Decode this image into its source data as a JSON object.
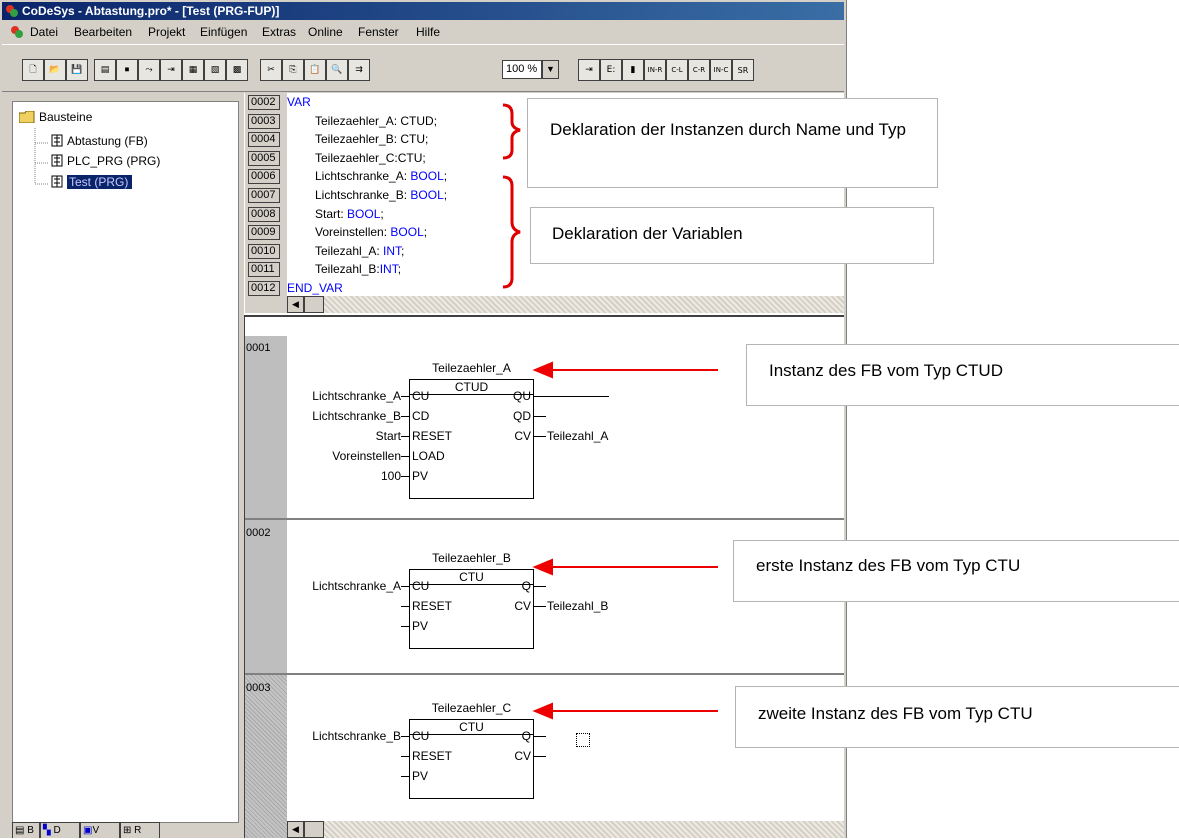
{
  "window": {
    "title": "CoDeSys - Abtastung.pro* - [Test (PRG-FUP)]"
  },
  "menu": [
    "Datei",
    "Bearbeiten",
    "Projekt",
    "Einfügen",
    "Extras",
    "Online",
    "Fenster",
    "Hilfe"
  ],
  "toolbar": {
    "zoom_value": "100 %",
    "fbd_buttons": [
      "⇥",
      "E:",
      "▮",
      "IN-R",
      "C-L",
      "C-R",
      "IN-C",
      "SR"
    ]
  },
  "tree": {
    "root": "Bausteine",
    "items": [
      "Abtastung (FB)",
      "PLC_PRG (PRG)",
      "Test (PRG)"
    ],
    "selected_index": 2,
    "tabs": [
      "B",
      "D",
      "V",
      "R"
    ]
  },
  "declaration": {
    "lines": [
      {
        "num": "0002",
        "text": "VAR",
        "type": ""
      },
      {
        "num": "0003",
        "text": "Teilezaehler_A: CTUD;",
        "type": ""
      },
      {
        "num": "0004",
        "text": "Teilezaehler_B: CTU;",
        "type": ""
      },
      {
        "num": "0005",
        "text": "Teilezaehler_C:CTU;",
        "type": ""
      },
      {
        "num": "0006",
        "text": "Lichtschranke_A: ",
        "type": "BOOL"
      },
      {
        "num": "0007",
        "text": "Lichtschranke_B: ",
        "type": "BOOL"
      },
      {
        "num": "0008",
        "text": "Start: ",
        "type": "BOOL"
      },
      {
        "num": "0009",
        "text": "Voreinstellen: ",
        "type": "BOOL"
      },
      {
        "num": "0010",
        "text": "Teilezahl_A: ",
        "type": "INT"
      },
      {
        "num": "0011",
        "text": "Teilezahl_B:",
        "type": "INT"
      },
      {
        "num": "0012",
        "text": "END_VAR",
        "type": ""
      }
    ]
  },
  "networks": [
    {
      "num": "0001",
      "instance": "Teilezaehler_A",
      "fb_type": "CTUD",
      "inputs": [
        {
          "pin": "CU",
          "signal": "Lichtschranke_A"
        },
        {
          "pin": "CD",
          "signal": "Lichtschranke_B"
        },
        {
          "pin": "RESET",
          "signal": "Start"
        },
        {
          "pin": "LOAD",
          "signal": "Voreinstellen"
        },
        {
          "pin": "PV",
          "signal": "100"
        }
      ],
      "outputs": [
        {
          "pin": "QU",
          "signal": ""
        },
        {
          "pin": "QD",
          "signal": ""
        },
        {
          "pin": "CV",
          "signal": "Teilezahl_A"
        }
      ]
    },
    {
      "num": "0002",
      "instance": "Teilezaehler_B",
      "fb_type": "CTU",
      "inputs": [
        {
          "pin": "CU",
          "signal": "Lichtschranke_A"
        },
        {
          "pin": "RESET",
          "signal": ""
        },
        {
          "pin": "PV",
          "signal": ""
        }
      ],
      "outputs": [
        {
          "pin": "Q",
          "signal": ""
        },
        {
          "pin": "CV",
          "signal": "Teilezahl_B"
        }
      ]
    },
    {
      "num": "0003",
      "instance": "Teilezaehler_C",
      "fb_type": "CTU",
      "inputs": [
        {
          "pin": "CU",
          "signal": "Lichtschranke_B"
        },
        {
          "pin": "RESET",
          "signal": ""
        },
        {
          "pin": "PV",
          "signal": ""
        }
      ],
      "outputs": [
        {
          "pin": "Q",
          "signal": ""
        },
        {
          "pin": "CV",
          "signal": ""
        }
      ]
    }
  ],
  "annotations": {
    "decl_instances": "Deklaration der Instanzen durch Name und Typ",
    "decl_variables": "Deklaration der Variablen",
    "net1": "Instanz des FB vom Typ CTUD",
    "net2": "erste  Instanz des FB vom Typ CTU",
    "net3": "zweite  Instanz des FB vom Typ CTU"
  },
  "colors": {
    "title_bar": "#0a246a",
    "keyword": "#0000ff",
    "annotation_bracket": "#dd0000",
    "annotation_arrow": "#ee0000"
  }
}
